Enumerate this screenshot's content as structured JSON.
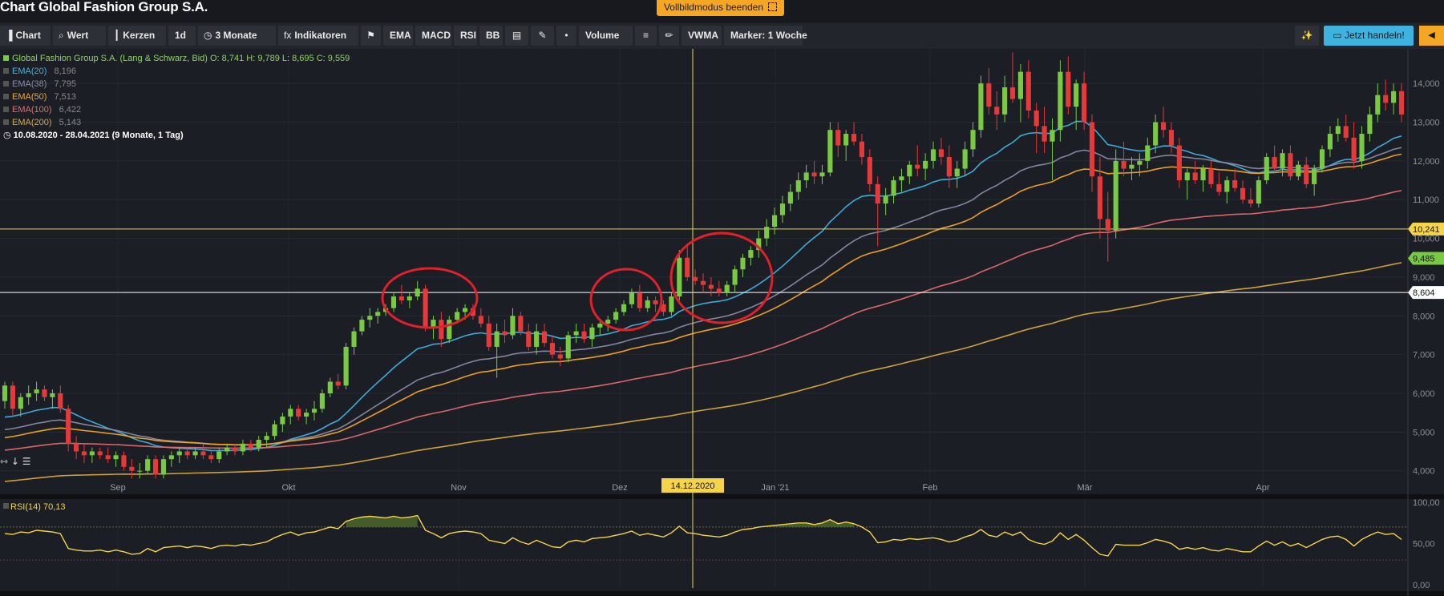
{
  "header": {
    "title": "Chart Global Fashion Group S.A.",
    "fullscreen_exit": "Vollbildmodus beenden"
  },
  "toolbar": {
    "buttons": [
      {
        "icon": "chart-icon",
        "glyph": "▐",
        "label": "Chart"
      },
      {
        "icon": "search-icon",
        "glyph": "⌕",
        "label": "Wert"
      },
      {
        "icon": "candles-icon",
        "glyph": "┃",
        "label": "Kerzen"
      },
      {
        "icon": "",
        "glyph": "",
        "label": "1d"
      },
      {
        "icon": "clock-icon",
        "glyph": "◷",
        "label": "3 Monate"
      },
      {
        "icon": "fx-icon",
        "glyph": "fx",
        "label": "Indikatoren"
      },
      {
        "icon": "bookmark-icon",
        "glyph": "⚑",
        "label": ""
      },
      {
        "icon": "",
        "glyph": "",
        "label": "EMA"
      },
      {
        "icon": "",
        "glyph": "",
        "label": "MACD"
      },
      {
        "icon": "",
        "glyph": "",
        "label": "RSI"
      },
      {
        "icon": "",
        "glyph": "",
        "label": "BB"
      },
      {
        "icon": "table-icon",
        "glyph": "▤",
        "label": ""
      },
      {
        "icon": "pen-tool-icon",
        "glyph": "✎",
        "label": ""
      },
      {
        "icon": "dot-line-icon",
        "glyph": "•",
        "label": ""
      },
      {
        "icon": "",
        "glyph": "",
        "label": "Volume"
      },
      {
        "icon": "sliders-icon",
        "glyph": "≡",
        "label": ""
      },
      {
        "icon": "pencil-icon",
        "glyph": "✏",
        "label": ""
      },
      {
        "icon": "",
        "glyph": "",
        "label": "VWMA"
      },
      {
        "icon": "",
        "glyph": "",
        "label": "Marker: 1 Woche"
      }
    ],
    "trade_label": "Jetzt handeln!",
    "trade_icon": "monitor-icon",
    "magic_icon": "sparkle-icon",
    "collapse_icon": "caret-left-icon"
  },
  "legend": {
    "main": "Global Fashion Group S.A. (Lang & Schwarz, Bid)  O: 8,741  H: 9,789  L: 8,695  C: 9,559",
    "period": "10.08.2020 - 28.04.2021  (9 Monate, 1 Tag)",
    "indicators": [
      {
        "label": "EMA(20)",
        "value": "8,196",
        "color": "#3fb3e0"
      },
      {
        "label": "EMA(38)",
        "value": "7,795",
        "color": "#8a8aa8"
      },
      {
        "label": "EMA(50)",
        "value": "7,513",
        "color": "#f5a623"
      },
      {
        "label": "EMA(100)",
        "value": "6,422",
        "color": "#e46a70"
      },
      {
        "label": "EMA(200)",
        "value": "5,143",
        "color": "#d8a93a"
      }
    ],
    "rsi": "RSI(14)  70,13"
  },
  "colors": {
    "up": "#7ac943",
    "down": "#e63939",
    "hline_yellow": "#f5d547",
    "hline_white": "#ffffff",
    "circle": "#e0202a",
    "rsi": "#f5d547"
  },
  "chart_data": {
    "type": "candlestick",
    "x_ticks": [
      "Sep",
      "Okt",
      "Nov",
      "Dez",
      "Jan '21",
      "Feb",
      "Mär",
      "Apr"
    ],
    "y_ticks": [
      "4,000",
      "5,000",
      "6,000",
      "7,000",
      "8,000",
      "9,000",
      "10,000",
      "11,000",
      "12,000",
      "13,000",
      "14,000"
    ],
    "ylim": [
      3.6,
      15.1
    ],
    "crosshair_date": "14.12.2020",
    "price_labels": [
      {
        "value": 10.241,
        "label": "10,241",
        "kind": "yellow"
      },
      {
        "value": 9.485,
        "label": "9,485",
        "kind": "green"
      },
      {
        "value": 8.604,
        "label": "8,604",
        "kind": "white"
      }
    ],
    "candles": [
      [
        5.8,
        6.3,
        5.6,
        6.2
      ],
      [
        6.2,
        6.3,
        5.4,
        5.6
      ],
      [
        5.6,
        6.0,
        5.4,
        5.9
      ],
      [
        5.9,
        6.2,
        5.7,
        6.0
      ],
      [
        6.0,
        6.3,
        5.8,
        6.1
      ],
      [
        6.1,
        6.2,
        5.8,
        5.9
      ],
      [
        5.9,
        6.1,
        5.6,
        6.0
      ],
      [
        6.0,
        6.2,
        5.5,
        5.6
      ],
      [
        5.6,
        5.7,
        4.5,
        4.7
      ],
      [
        4.7,
        4.9,
        4.3,
        4.5
      ],
      [
        4.5,
        4.7,
        4.2,
        4.4
      ],
      [
        4.4,
        4.6,
        4.2,
        4.5
      ],
      [
        4.5,
        4.6,
        4.3,
        4.4
      ],
      [
        4.4,
        4.6,
        4.2,
        4.3
      ],
      [
        4.3,
        4.5,
        4.1,
        4.4
      ],
      [
        4.4,
        4.5,
        4.0,
        4.1
      ],
      [
        4.1,
        4.3,
        3.8,
        4.0
      ],
      [
        4.0,
        4.2,
        3.8,
        4.0
      ],
      [
        4.0,
        4.4,
        3.9,
        4.3
      ],
      [
        4.3,
        4.4,
        3.8,
        3.9
      ],
      [
        3.9,
        4.4,
        3.8,
        4.3
      ],
      [
        4.3,
        4.5,
        4.1,
        4.4
      ],
      [
        4.4,
        4.6,
        4.2,
        4.5
      ],
      [
        4.5,
        4.6,
        4.3,
        4.4
      ],
      [
        4.4,
        4.6,
        4.3,
        4.5
      ],
      [
        4.5,
        4.7,
        4.3,
        4.4
      ],
      [
        4.4,
        4.5,
        4.2,
        4.3
      ],
      [
        4.3,
        4.6,
        4.2,
        4.5
      ],
      [
        4.5,
        4.7,
        4.4,
        4.6
      ],
      [
        4.6,
        4.7,
        4.4,
        4.5
      ],
      [
        4.5,
        4.8,
        4.4,
        4.7
      ],
      [
        4.7,
        4.8,
        4.5,
        4.6
      ],
      [
        4.6,
        4.9,
        4.5,
        4.8
      ],
      [
        4.8,
        5.0,
        4.6,
        4.9
      ],
      [
        4.9,
        5.3,
        4.8,
        5.2
      ],
      [
        5.2,
        5.5,
        5.0,
        5.4
      ],
      [
        5.4,
        5.7,
        5.2,
        5.6
      ],
      [
        5.6,
        5.7,
        5.3,
        5.4
      ],
      [
        5.4,
        5.6,
        5.2,
        5.5
      ],
      [
        5.5,
        5.8,
        5.3,
        5.6
      ],
      [
        5.6,
        6.1,
        5.5,
        6.0
      ],
      [
        6.0,
        6.4,
        5.9,
        6.3
      ],
      [
        6.3,
        6.5,
        6.1,
        6.2
      ],
      [
        6.2,
        7.3,
        6.1,
        7.2
      ],
      [
        7.2,
        7.7,
        7.0,
        7.6
      ],
      [
        7.6,
        8.0,
        7.5,
        7.9
      ],
      [
        7.9,
        8.2,
        7.7,
        8.0
      ],
      [
        8.0,
        8.2,
        7.8,
        8.1
      ],
      [
        8.1,
        8.3,
        8.0,
        8.2
      ],
      [
        8.2,
        8.6,
        8.1,
        8.5
      ],
      [
        8.5,
        8.8,
        8.3,
        8.4
      ],
      [
        8.4,
        8.6,
        8.2,
        8.5
      ],
      [
        8.5,
        8.9,
        8.4,
        8.7
      ],
      [
        8.7,
        8.8,
        7.6,
        7.7
      ],
      [
        7.7,
        8.0,
        7.4,
        7.9
      ],
      [
        7.9,
        8.1,
        7.2,
        7.4
      ],
      [
        7.4,
        8.0,
        7.3,
        7.9
      ],
      [
        7.9,
        8.2,
        7.8,
        8.1
      ],
      [
        8.1,
        8.3,
        7.9,
        8.2
      ],
      [
        8.2,
        8.3,
        7.9,
        8.0
      ],
      [
        8.0,
        8.2,
        7.7,
        7.8
      ],
      [
        7.8,
        8.0,
        7.1,
        7.2
      ],
      [
        7.2,
        7.8,
        6.4,
        7.6
      ],
      [
        7.6,
        7.9,
        7.3,
        7.5
      ],
      [
        7.5,
        8.2,
        7.4,
        8.0
      ],
      [
        8.0,
        8.1,
        7.5,
        7.6
      ],
      [
        7.6,
        7.8,
        7.1,
        7.2
      ],
      [
        7.2,
        7.8,
        7.0,
        7.6
      ],
      [
        7.6,
        7.8,
        7.2,
        7.3
      ],
      [
        7.3,
        7.5,
        6.9,
        7.0
      ],
      [
        7.0,
        7.2,
        6.7,
        6.9
      ],
      [
        6.9,
        7.6,
        6.8,
        7.5
      ],
      [
        7.5,
        7.8,
        7.3,
        7.6
      ],
      [
        7.6,
        7.8,
        7.3,
        7.4
      ],
      [
        7.4,
        7.8,
        7.2,
        7.7
      ],
      [
        7.7,
        7.9,
        7.5,
        7.8
      ],
      [
        7.8,
        8.0,
        7.6,
        7.9
      ],
      [
        7.9,
        8.2,
        7.8,
        8.1
      ],
      [
        8.1,
        8.4,
        8.0,
        8.3
      ],
      [
        8.3,
        8.7,
        8.2,
        8.6
      ],
      [
        8.6,
        8.8,
        8.1,
        8.2
      ],
      [
        8.2,
        8.5,
        8.1,
        8.4
      ],
      [
        8.4,
        8.5,
        8.1,
        8.3
      ],
      [
        8.3,
        8.4,
        8.0,
        8.1
      ],
      [
        8.1,
        8.6,
        8.0,
        8.5
      ],
      [
        8.5,
        9.7,
        8.4,
        9.5
      ],
      [
        9.5,
        9.8,
        8.9,
        9.0
      ],
      [
        9.0,
        9.2,
        8.8,
        8.9
      ],
      [
        8.9,
        9.1,
        8.6,
        8.8
      ],
      [
        8.8,
        9.0,
        8.5,
        8.7
      ],
      [
        8.7,
        8.9,
        8.5,
        8.6
      ],
      [
        8.6,
        8.9,
        8.5,
        8.8
      ],
      [
        8.8,
        9.3,
        8.6,
        9.2
      ],
      [
        9.2,
        9.6,
        9.0,
        9.5
      ],
      [
        9.5,
        9.8,
        9.3,
        9.7
      ],
      [
        9.7,
        10.2,
        9.5,
        10.0
      ],
      [
        10.0,
        10.5,
        9.8,
        10.3
      ],
      [
        10.3,
        10.8,
        10.1,
        10.6
      ],
      [
        10.6,
        11.1,
        10.4,
        10.9
      ],
      [
        10.9,
        11.4,
        10.7,
        11.2
      ],
      [
        11.2,
        11.7,
        11.0,
        11.5
      ],
      [
        11.5,
        11.9,
        11.3,
        11.7
      ],
      [
        11.7,
        12.0,
        11.4,
        11.6
      ],
      [
        11.6,
        11.9,
        11.4,
        11.7
      ],
      [
        11.7,
        13.0,
        11.6,
        12.8
      ],
      [
        12.8,
        13.0,
        12.1,
        12.4
      ],
      [
        12.4,
        12.8,
        12.0,
        12.7
      ],
      [
        12.7,
        13.0,
        12.4,
        12.5
      ],
      [
        12.5,
        12.7,
        11.9,
        12.1
      ],
      [
        12.1,
        12.3,
        11.2,
        11.4
      ],
      [
        11.4,
        11.6,
        9.8,
        10.9
      ],
      [
        10.9,
        11.3,
        10.6,
        11.1
      ],
      [
        11.1,
        11.6,
        10.9,
        11.5
      ],
      [
        11.5,
        11.8,
        11.2,
        11.6
      ],
      [
        11.6,
        12.0,
        11.4,
        11.9
      ],
      [
        11.9,
        12.4,
        11.6,
        11.8
      ],
      [
        11.8,
        12.2,
        11.5,
        12.0
      ],
      [
        12.0,
        12.5,
        11.8,
        12.3
      ],
      [
        12.3,
        12.6,
        11.9,
        12.1
      ],
      [
        12.1,
        12.4,
        11.3,
        11.6
      ],
      [
        11.6,
        12.0,
        11.3,
        11.8
      ],
      [
        11.8,
        12.5,
        11.6,
        12.3
      ],
      [
        12.3,
        13.0,
        12.1,
        12.8
      ],
      [
        12.8,
        14.2,
        12.6,
        14.0
      ],
      [
        14.0,
        14.4,
        13.2,
        13.4
      ],
      [
        13.4,
        13.8,
        12.8,
        13.2
      ],
      [
        13.2,
        14.2,
        13.0,
        13.9
      ],
      [
        13.9,
        14.8,
        13.5,
        13.6
      ],
      [
        13.6,
        14.5,
        13.0,
        14.3
      ],
      [
        14.3,
        14.6,
        13.1,
        13.3
      ],
      [
        13.3,
        13.5,
        12.2,
        12.9
      ],
      [
        12.9,
        13.4,
        12.2,
        12.5
      ],
      [
        12.5,
        13.1,
        11.5,
        12.8
      ],
      [
        12.8,
        14.6,
        12.5,
        14.3
      ],
      [
        14.3,
        14.7,
        13.2,
        13.4
      ],
      [
        13.4,
        14.1,
        12.8,
        14.0
      ],
      [
        14.0,
        14.3,
        12.8,
        13.0
      ],
      [
        13.0,
        13.2,
        11.2,
        11.6
      ],
      [
        11.6,
        12.1,
        10.0,
        10.5
      ],
      [
        10.5,
        11.2,
        9.4,
        10.2
      ],
      [
        10.2,
        12.3,
        10.0,
        12.0
      ],
      [
        12.0,
        12.5,
        11.6,
        11.8
      ],
      [
        11.8,
        12.1,
        11.5,
        11.9
      ],
      [
        11.9,
        12.2,
        11.6,
        12.0
      ],
      [
        12.0,
        12.6,
        11.8,
        12.4
      ],
      [
        12.4,
        13.2,
        12.2,
        13.0
      ],
      [
        13.0,
        13.4,
        12.6,
        12.8
      ],
      [
        12.8,
        13.0,
        12.2,
        12.4
      ],
      [
        12.4,
        12.6,
        11.3,
        11.5
      ],
      [
        11.5,
        11.8,
        11.0,
        11.7
      ],
      [
        11.7,
        12.0,
        11.4,
        11.5
      ],
      [
        11.5,
        11.9,
        11.2,
        11.8
      ],
      [
        11.8,
        12.0,
        11.3,
        11.4
      ],
      [
        11.4,
        11.7,
        11.1,
        11.2
      ],
      [
        11.2,
        11.6,
        10.9,
        11.5
      ],
      [
        11.5,
        11.8,
        11.2,
        11.3
      ],
      [
        11.3,
        11.5,
        10.9,
        11.0
      ],
      [
        11.0,
        11.3,
        10.8,
        10.9
      ],
      [
        10.9,
        11.6,
        10.8,
        11.5
      ],
      [
        11.5,
        12.2,
        11.4,
        12.1
      ],
      [
        12.1,
        12.4,
        11.7,
        11.8
      ],
      [
        11.8,
        12.3,
        11.6,
        12.2
      ],
      [
        12.2,
        12.4,
        11.5,
        11.6
      ],
      [
        11.6,
        12.0,
        11.5,
        11.9
      ],
      [
        11.9,
        12.1,
        11.3,
        11.4
      ],
      [
        11.4,
        11.9,
        11.1,
        11.8
      ],
      [
        11.8,
        12.4,
        11.7,
        12.3
      ],
      [
        12.3,
        12.9,
        12.1,
        12.7
      ],
      [
        12.7,
        13.1,
        12.5,
        12.9
      ],
      [
        12.9,
        13.2,
        12.5,
        12.6
      ],
      [
        12.6,
        13.0,
        11.8,
        12.0
      ],
      [
        12.0,
        12.9,
        11.8,
        12.7
      ],
      [
        12.7,
        13.4,
        12.5,
        13.2
      ],
      [
        13.2,
        14.0,
        13.0,
        13.7
      ],
      [
        13.7,
        14.1,
        13.3,
        13.5
      ],
      [
        13.5,
        14.0,
        13.2,
        13.8
      ],
      [
        13.8,
        14.0,
        13.0,
        13.2
      ]
    ],
    "rsi": {
      "ylim": [
        0,
        100
      ],
      "levels": [
        70,
        30
      ],
      "y_ticks": [
        "100,00",
        "50,00",
        "0,00"
      ],
      "values": [
        62,
        61,
        64,
        63,
        66,
        65,
        64,
        62,
        44,
        42,
        41,
        41,
        42,
        40,
        42,
        40,
        37,
        38,
        44,
        40,
        45,
        46,
        47,
        45,
        47,
        46,
        44,
        47,
        48,
        47,
        49,
        48,
        50,
        52,
        57,
        61,
        64,
        60,
        63,
        64,
        67,
        70,
        68,
        77,
        80,
        82,
        83,
        82,
        81,
        83,
        81,
        82,
        84,
        66,
        62,
        57,
        62,
        64,
        65,
        64,
        62,
        54,
        52,
        50,
        57,
        52,
        49,
        54,
        50,
        46,
        45,
        52,
        54,
        52,
        56,
        57,
        58,
        60,
        62,
        65,
        60,
        62,
        60,
        58,
        63,
        71,
        63,
        62,
        60,
        59,
        58,
        60,
        64,
        67,
        68,
        70,
        71,
        72,
        73,
        74,
        75,
        75,
        73,
        75,
        79,
        74,
        76,
        74,
        70,
        64,
        51,
        52,
        55,
        54,
        56,
        55,
        56,
        57,
        55,
        52,
        54,
        58,
        61,
        67,
        60,
        58,
        64,
        60,
        64,
        55,
        51,
        49,
        53,
        63,
        55,
        61,
        54,
        45,
        37,
        35,
        49,
        48,
        48,
        48,
        51,
        55,
        53,
        50,
        43,
        45,
        43,
        45,
        42,
        41,
        44,
        42,
        40,
        40,
        47,
        53,
        48,
        52,
        47,
        50,
        45,
        50,
        55,
        58,
        59,
        55,
        47,
        55,
        60,
        64,
        61,
        62,
        55
      ]
    }
  }
}
